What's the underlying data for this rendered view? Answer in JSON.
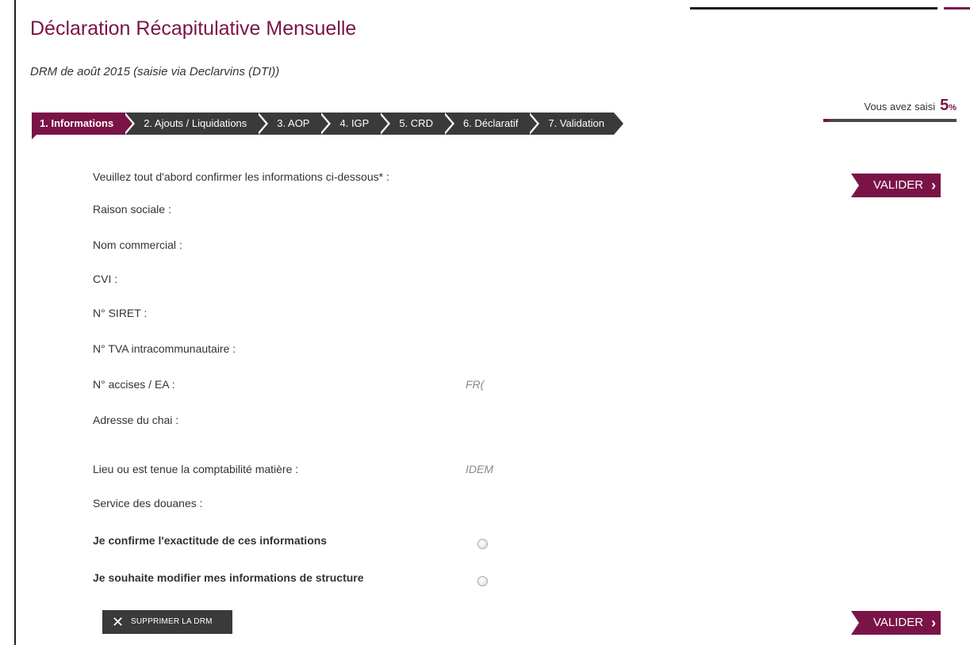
{
  "header": {
    "title": "Déclaration Récapitulative Mensuelle",
    "subtitle": "DRM de août 2015 (saisie via Declarvins (DTI))"
  },
  "progress": {
    "label": "Vous avez saisi",
    "value": "5",
    "unit": "%",
    "fraction": 0.05
  },
  "steps": [
    {
      "label": "1. Informations",
      "active": true
    },
    {
      "label": "2. Ajouts / Liquidations",
      "active": false
    },
    {
      "label": "3. AOP",
      "active": false
    },
    {
      "label": "4. IGP",
      "active": false
    },
    {
      "label": "5. CRD",
      "active": false
    },
    {
      "label": "6. Déclaratif",
      "active": false
    },
    {
      "label": "7. Validation",
      "active": false
    }
  ],
  "actions": {
    "validate_label": "VALIDER",
    "delete_label": "SUPPRIMER LA DRM"
  },
  "form": {
    "intro": "Veuillez tout d'abord confirmer les informations ci-dessous* :",
    "fields": [
      {
        "label": "Raison sociale :",
        "value": ""
      },
      {
        "label": "Nom commercial :",
        "value": ""
      },
      {
        "label": "CVI :",
        "value": ""
      },
      {
        "label": "N° SIRET :",
        "value": ""
      },
      {
        "label": "N° TVA intracommunautaire :",
        "value": ""
      },
      {
        "label": "N° accises / EA :",
        "value": "FR("
      },
      {
        "label": "Adresse du chai :",
        "value": ""
      },
      {
        "label": "Lieu ou est tenue la comptabilité matière :",
        "value": "IDEM"
      },
      {
        "label": "Service des douanes :",
        "value": ""
      }
    ],
    "confirm_label": "Je confirme l'exactitude de ces informations",
    "modify_label": "Je souhaite modifier mes informations de structure"
  },
  "colors": {
    "accent": "#7a1446",
    "dark": "#3a3a3a"
  }
}
